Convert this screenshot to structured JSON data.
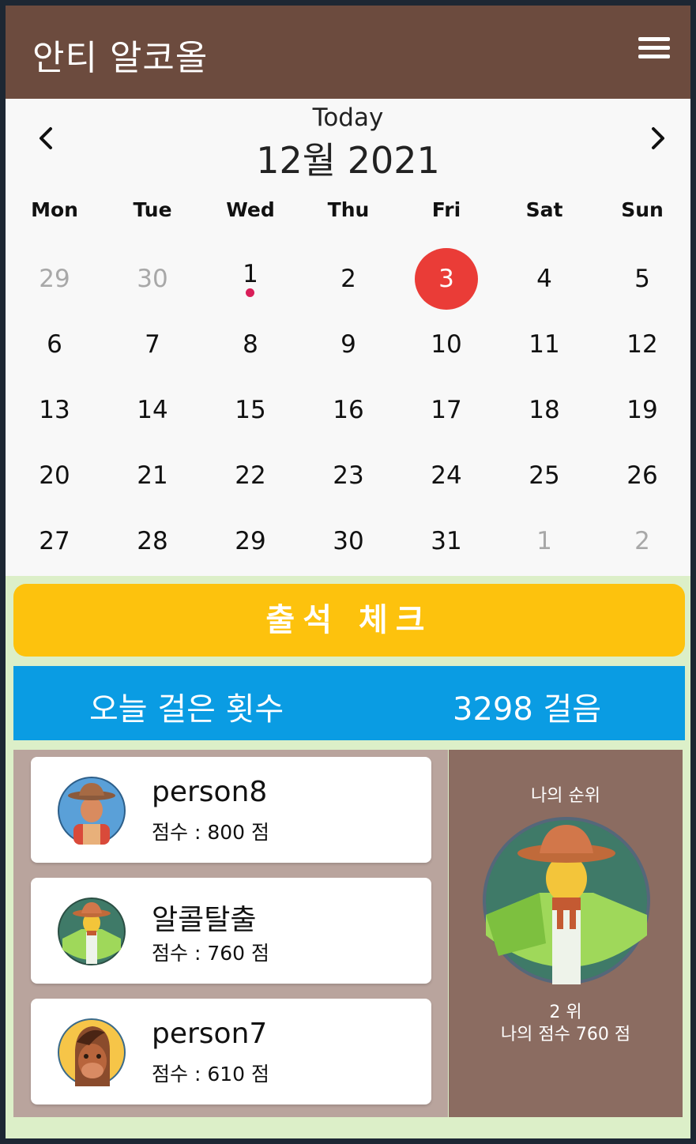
{
  "app": {
    "title": "안티 알코올"
  },
  "calendar": {
    "today_label": "Today",
    "month_label": "12월 2021",
    "weekdays": [
      "Mon",
      "Tue",
      "Wed",
      "Thu",
      "Fri",
      "Sat",
      "Sun"
    ],
    "weeks": [
      [
        "29",
        "30",
        "1",
        "2",
        "3",
        "4",
        "5"
      ],
      [
        "6",
        "7",
        "8",
        "9",
        "10",
        "11",
        "12"
      ],
      [
        "13",
        "14",
        "15",
        "16",
        "17",
        "18",
        "19"
      ],
      [
        "20",
        "21",
        "22",
        "23",
        "24",
        "25",
        "26"
      ],
      [
        "27",
        "28",
        "29",
        "30",
        "31",
        "1",
        "2"
      ]
    ],
    "selected_day": "3",
    "accent_color": "#ea3c37",
    "event_dot_color": "#d91f59"
  },
  "attendance": {
    "button_label": "출석 체크"
  },
  "steps": {
    "label": "오늘 걸은 횟수",
    "value": "3298 걸음"
  },
  "ranking": [
    {
      "name": "person8",
      "score": "점수 : 800 점",
      "avatar_icon": "farmer-avatar-icon"
    },
    {
      "name": "알콜탈출",
      "score": "점수 : 760 점",
      "avatar_icon": "scarecrow-avatar-icon"
    },
    {
      "name": "person7",
      "score": "점수 : 610 점",
      "avatar_icon": "horse-avatar-icon"
    }
  ],
  "my_rank": {
    "title": "나의 순위",
    "rank": "2 위",
    "score": "나의 점수 760 점",
    "avatar_icon": "scarecrow-avatar-icon"
  },
  "colors": {
    "appbar": "#6c4b3e",
    "attend_button": "#fdc20d",
    "steps_bar": "#0a9ce3",
    "ranking_panel": "#b9a49d",
    "my_panel": "#8b6c61",
    "background": "#dcefc8"
  }
}
